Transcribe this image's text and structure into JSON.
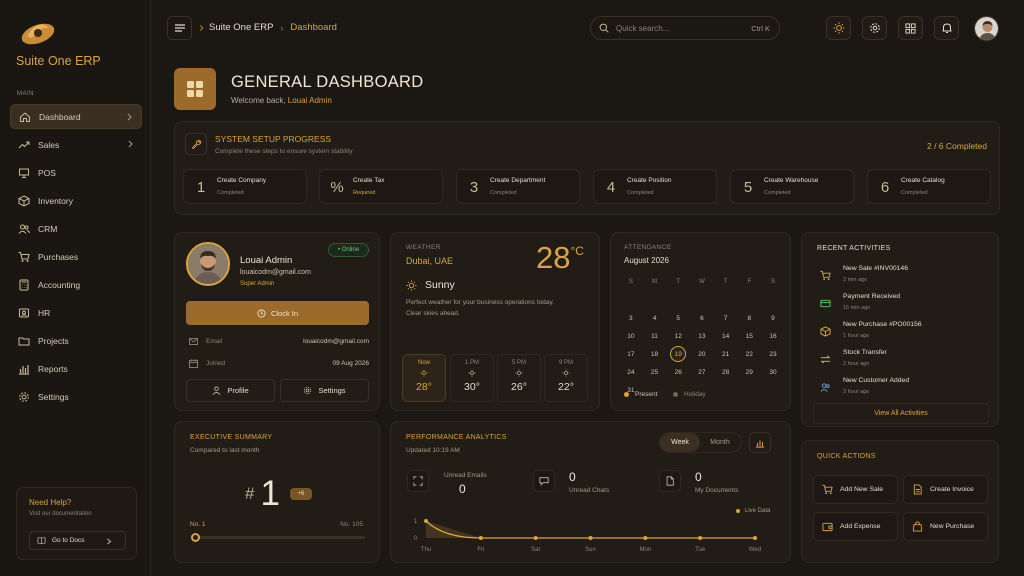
{
  "app": {
    "name": "Suite One ERP"
  },
  "sidebar": {
    "section_label": "MAIN",
    "items": [
      {
        "label": "Dashboard",
        "icon": "home-icon",
        "active": true,
        "has_children": true
      },
      {
        "label": "Sales",
        "icon": "trend-icon",
        "has_children": true
      },
      {
        "label": "POS",
        "icon": "monitor-icon"
      },
      {
        "label": "Inventory",
        "icon": "box-icon"
      },
      {
        "label": "CRM",
        "icon": "users-icon"
      },
      {
        "label": "Purchases",
        "icon": "cart-icon"
      },
      {
        "label": "Accounting",
        "icon": "calculator-icon"
      },
      {
        "label": "HR",
        "icon": "id-card-icon"
      },
      {
        "label": "Projects",
        "icon": "folder-icon"
      },
      {
        "label": "Reports",
        "icon": "bar-chart-icon"
      },
      {
        "label": "Settings",
        "icon": "gear-icon"
      }
    ],
    "help": {
      "title": "Need Help?",
      "subtitle": "Visit our documentation",
      "button": "Go to Docs"
    }
  },
  "topbar": {
    "breadcrumb": [
      "Suite One ERP",
      "Dashboard"
    ],
    "search_placeholder": "Quick search...",
    "search_shortcut": "Ctrl K"
  },
  "header": {
    "title": "GENERAL DASHBOARD",
    "welcome": "Welcome back,",
    "user": "Louai Admin"
  },
  "setup": {
    "title": "SYSTEM SETUP PROGRESS",
    "subtitle": "Complete these steps to ensure system stability",
    "progress": "2 / 6 Completed",
    "steps": [
      {
        "num": "1",
        "label": "Create Company",
        "status": "Completed"
      },
      {
        "num": "%",
        "label": "Create Tax",
        "status": "Required"
      },
      {
        "num": "3",
        "label": "Create Department",
        "status": "Completed"
      },
      {
        "num": "4",
        "label": "Create Position",
        "status": "Completed"
      },
      {
        "num": "5",
        "label": "Create Warehouse",
        "status": "Completed"
      },
      {
        "num": "6",
        "label": "Create Catalog",
        "status": "Completed"
      }
    ]
  },
  "profile": {
    "name": "Louai Admin",
    "email": "louaicodm@gmail.com",
    "role": "Super Admin",
    "status": "• Online",
    "clock_in": "Clock In",
    "email_label": "Email",
    "email_value": "louaicodm@gmail.com",
    "joined_label": "Joined",
    "joined_value": "09 Aug 2026",
    "profile_btn": "Profile",
    "settings_btn": "Settings"
  },
  "weather": {
    "label": "WEATHER",
    "location": "Dubai, UAE",
    "temp": "28",
    "unit": "°C",
    "condition": "Sunny",
    "description": "Perfect weather for your business operations today. Clear skies ahead.",
    "forecast": [
      {
        "hour": "Now",
        "temp": "28°"
      },
      {
        "hour": "1 PM",
        "temp": "30°"
      },
      {
        "hour": "5 PM",
        "temp": "26°"
      },
      {
        "hour": "9 PM",
        "temp": "22°"
      }
    ]
  },
  "attendance": {
    "label": "ATTENDANCE",
    "month": "August 2026",
    "weekdays": [
      "S",
      "M",
      "T",
      "W",
      "T",
      "F",
      "S"
    ],
    "weeks": [
      [
        "",
        "",
        "",
        "",
        "",
        "",
        ""
      ],
      [
        "3",
        "4",
        "5",
        "6",
        "7",
        "8",
        "9"
      ],
      [
        "10",
        "11",
        "12",
        "13",
        "14",
        "15",
        "16"
      ],
      [
        "17",
        "18",
        "19",
        "20",
        "21",
        "22",
        "23"
      ],
      [
        "24",
        "25",
        "26",
        "27",
        "28",
        "29",
        "30"
      ],
      [
        "31",
        "",
        "",
        "",
        "",
        "",
        ""
      ]
    ],
    "today": "19",
    "legend_present": "Present",
    "legend_holiday": "Holiday"
  },
  "activities": {
    "title": "RECENT ACTIVITIES",
    "items": [
      {
        "title": "New Sale #INV00146",
        "time": "2 min ago",
        "icon": "cart-icon"
      },
      {
        "title": "Payment Received",
        "time": "15 min ago",
        "icon": "card-icon"
      },
      {
        "title": "New Purchase #PO00156",
        "time": "1 hour ago",
        "icon": "box-icon"
      },
      {
        "title": "Stock Transfer",
        "time": "2 hour ago",
        "icon": "transfer-icon"
      },
      {
        "title": "New Customer Added",
        "time": "3 hour ago",
        "icon": "users-icon"
      }
    ],
    "view_all": "View All Activities"
  },
  "executive": {
    "title": "EXECUTIVE SUMMARY",
    "subtitle": "Compared to last month",
    "rank_prefix": "#",
    "rank": "1",
    "change": "+6",
    "left_label": "No. 1",
    "right_label": "No. 105",
    "slider_fraction": 0.0
  },
  "performance": {
    "title": "PERFORMANCE ANALYTICS",
    "updated": "Updated 10:19 AM",
    "tab_week": "Week",
    "tab_month": "Month",
    "stats": [
      {
        "label": "Unread Emails",
        "value": "0"
      },
      {
        "label": "Unread Chats",
        "value": "0"
      },
      {
        "label": "My Documents",
        "value": "0"
      }
    ],
    "live_label": "Live Data"
  },
  "chart_data": {
    "type": "area",
    "categories": [
      "Thu",
      "Fri",
      "Sat",
      "Sun",
      "Mon",
      "Tue",
      "Wed"
    ],
    "values": [
      1,
      0,
      0,
      0,
      0,
      0,
      0
    ],
    "ylim": [
      0,
      1
    ],
    "yticks": [
      "1",
      "0"
    ],
    "series": [
      {
        "name": "Live Data",
        "values": [
          1,
          0,
          0,
          0,
          0,
          0,
          0
        ]
      }
    ],
    "grid": false,
    "color": "#d9a441"
  },
  "quick_actions": {
    "title": "QUICK ACTIONS",
    "buttons": [
      {
        "label": "Add New Sale",
        "icon": "cart-icon"
      },
      {
        "label": "Create Invoice",
        "icon": "invoice-icon"
      },
      {
        "label": "Add Expense",
        "icon": "wallet-icon"
      },
      {
        "label": "New Purchase",
        "icon": "bag-icon"
      }
    ]
  },
  "colors": {
    "accent": "#d9a441",
    "background": "#1b1712",
    "card": "#211c16",
    "online": "#5fcf73"
  }
}
